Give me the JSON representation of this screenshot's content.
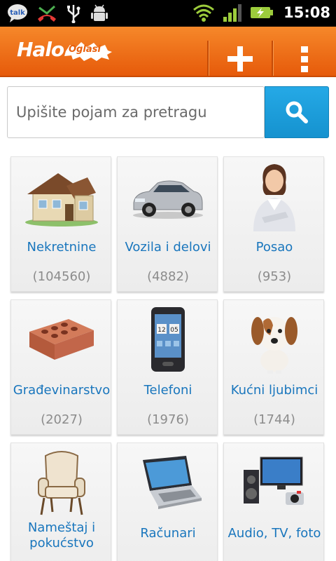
{
  "status_bar": {
    "time": "15:08",
    "left_icons": [
      "talk-icon",
      "missed-call-icon",
      "usb-icon",
      "android-debug-icon"
    ],
    "right_icons": [
      "wifi-icon",
      "signal-icon",
      "battery-charging-icon"
    ]
  },
  "app_bar": {
    "logo_main": "Halo",
    "logo_sub": "Oglasi",
    "add_icon": "plus-icon",
    "menu_icon": "overflow-menu-icon",
    "brand_color": "#f0731a"
  },
  "search": {
    "placeholder": "Upišite pojam za pretragu",
    "value": "",
    "button_icon": "search-icon",
    "button_color": "#1e9fdc"
  },
  "categories": [
    {
      "label": "Nekretnine",
      "count": "(104560)",
      "icon": "house-icon"
    },
    {
      "label": "Vozila i delovi",
      "count": "(4882)",
      "icon": "car-icon"
    },
    {
      "label": "Posao",
      "count": "(953)",
      "icon": "businesswoman-icon"
    },
    {
      "label": "Građevinarstvo",
      "count": "(2027)",
      "icon": "brick-icon"
    },
    {
      "label": "Telefoni",
      "count": "(1976)",
      "icon": "phone-icon"
    },
    {
      "label": "Kućni ljubimci",
      "count": "(1744)",
      "icon": "dog-icon"
    },
    {
      "label": "Nameštaj i pokućstvo",
      "count": "",
      "icon": "armchair-icon"
    },
    {
      "label": "Računari",
      "count": "",
      "icon": "laptop-icon"
    },
    {
      "label": "Audio, TV, foto",
      "count": "",
      "icon": "tv-audio-icon"
    }
  ],
  "phone_clock": {
    "hours": "12",
    "minutes": "05"
  }
}
